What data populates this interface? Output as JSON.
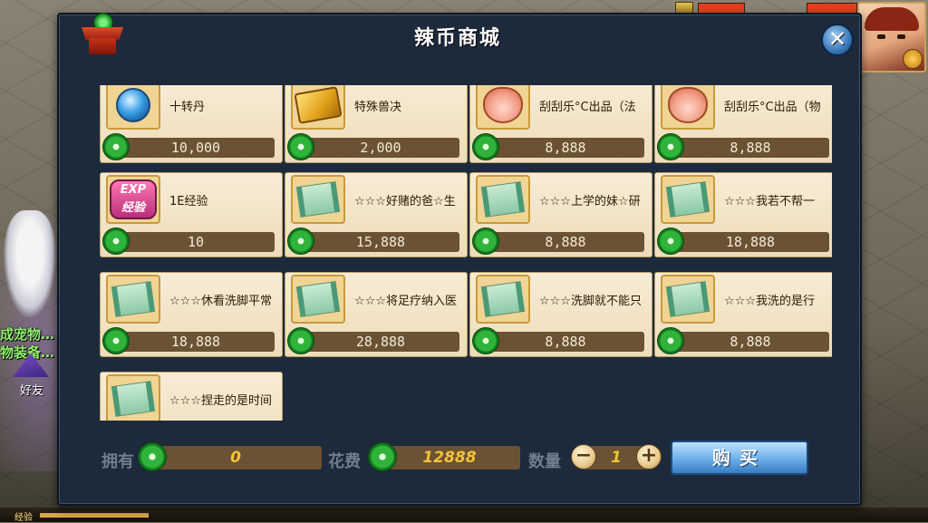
{
  "window": {
    "title": "辣币商城"
  },
  "shop": {
    "items": [
      {
        "name": "十转丹",
        "price": "10,000",
        "icon": "orb-icon"
      },
      {
        "name": "特殊兽决",
        "price": "2,000",
        "icon": "gold-book-icon"
      },
      {
        "name": "刮刮乐°C出品（法",
        "price": "8,888",
        "icon": "lucky-bag-icon"
      },
      {
        "name": "刮刮乐°C出品（物",
        "price": "8,888",
        "icon": "lucky-bag-icon"
      },
      {
        "name": "1E经验",
        "price": "10",
        "icon": "exp-icon",
        "icon_text_top": "EXP",
        "icon_text_bottom": "经验"
      },
      {
        "name": "☆☆☆好赌的爸☆生",
        "price": "15,888",
        "icon": "scroll-icon"
      },
      {
        "name": "☆☆☆上学的妹☆研",
        "price": "8,888",
        "icon": "scroll-icon"
      },
      {
        "name": "☆☆☆我若不帮一",
        "price": "18,888",
        "icon": "scroll-icon"
      },
      {
        "name": "☆☆☆休看洗脚平常",
        "price": "18,888",
        "icon": "scroll-icon"
      },
      {
        "name": "☆☆☆将足疗纳入医",
        "price": "28,888",
        "icon": "scroll-icon"
      },
      {
        "name": "☆☆☆洗脚就不能只",
        "price": "8,888",
        "icon": "scroll-icon"
      },
      {
        "name": "☆☆☆我洗的是行",
        "price": "8,888",
        "icon": "scroll-icon"
      },
      {
        "name": "☆☆☆捏走的是时间",
        "price": "",
        "icon": "scroll-icon"
      }
    ]
  },
  "footer": {
    "own_label": "拥有",
    "own_value": "0",
    "cost_label": "花费",
    "cost_value": "12888",
    "qty_label": "数量",
    "qty_value": "1",
    "minus": "−",
    "plus": "+",
    "buy_label": "购买"
  },
  "background": {
    "left_text_1": "成宠物…",
    "left_text_2": "物装备…",
    "friend_label": "好友",
    "exp_label": "经验"
  },
  "hud": {
    "hp_fraction": 1.0,
    "mp_fraction": 1.0
  },
  "colors": {
    "panel": "#1c2a3c",
    "card": "#f2e4c6",
    "price_bar": "#6a5233",
    "coin": "#2fb33a",
    "buy_button": "#6aaee8",
    "title": "#ffffff"
  }
}
